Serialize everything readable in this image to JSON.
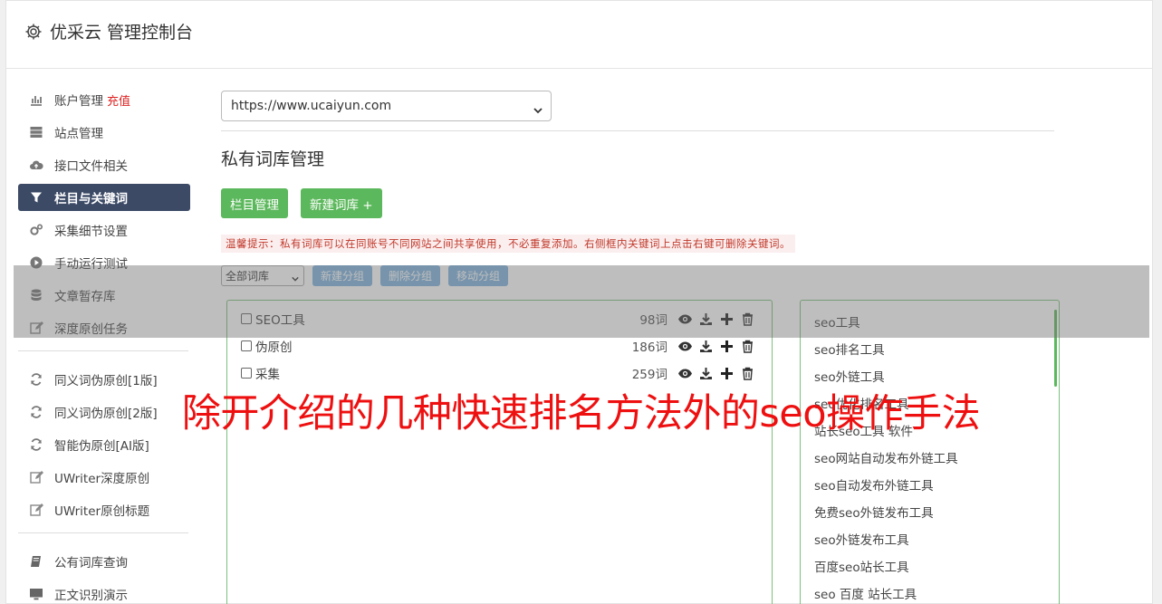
{
  "header": {
    "title": "优采云 管理控制台"
  },
  "sidebar": {
    "items": [
      {
        "label": "账户管理",
        "badge": "充值",
        "icon": "bar-chart-icon"
      },
      {
        "label": "站点管理",
        "icon": "server-icon"
      },
      {
        "label": "接口文件相关",
        "icon": "cloud-upload-icon"
      },
      {
        "label": "栏目与关键词",
        "icon": "filter-icon",
        "active": true
      },
      {
        "label": "采集细节设置",
        "icon": "gears-icon"
      },
      {
        "label": "手动运行测试",
        "icon": "play-circle-icon"
      },
      {
        "label": "文章暂存库",
        "icon": "database-icon"
      },
      {
        "label": "深度原创任务",
        "icon": "edit-icon"
      }
    ],
    "items2": [
      {
        "label": "同义词伪原创[1版]",
        "icon": "refresh-icon"
      },
      {
        "label": "同义词伪原创[2版]",
        "icon": "refresh-icon"
      },
      {
        "label": "智能伪原创[AI版]",
        "icon": "refresh-icon"
      },
      {
        "label": "UWriter深度原创",
        "icon": "edit-icon"
      },
      {
        "label": "UWriter原创标题",
        "icon": "edit-icon"
      }
    ],
    "items3": [
      {
        "label": "公有词库查询",
        "icon": "book-icon"
      },
      {
        "label": "正文识别演示",
        "icon": "monitor-icon"
      }
    ]
  },
  "main": {
    "site_select": "https://www.ucaiyun.com",
    "page_title": "私有词库管理",
    "btn_column": "栏目管理",
    "btn_new_lib": "新建词库 +",
    "tip": "温馨提示：私有词库可以在同账号不同网站之间共享使用，不必重复添加。右侧框内关键词上点击右键可删除关键词。",
    "group_select": "全部词库",
    "btn_new_group": "新建分组",
    "btn_del_group": "删除分组",
    "btn_move_group": "移动分组",
    "libraries": [
      {
        "name": "SEO工具",
        "count": "98词"
      },
      {
        "name": "伪原创",
        "count": "186词"
      },
      {
        "name": "采集",
        "count": "259词"
      }
    ],
    "keywords": [
      "seo工具",
      "seo排名工具",
      "seo外链工具",
      "seo优化排名工具",
      "站长seo工具 软件",
      "seo网站自动发布外链工具",
      "seo自动发布外链工具",
      "免费seo外链发布工具",
      "seo外链发布工具",
      "百度seo站长工具",
      "seo 百度 站长工具"
    ]
  },
  "caption": "除开介绍的几种快速排名方法外的seo操作手法"
}
